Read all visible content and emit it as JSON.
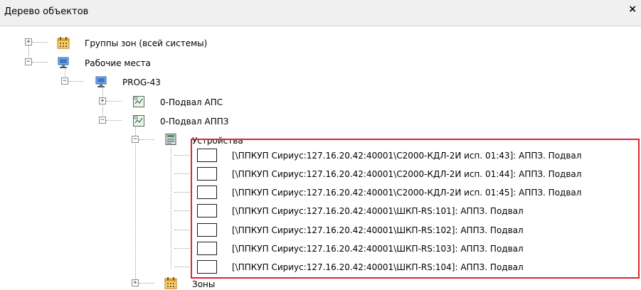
{
  "panel": {
    "title": "Дерево объектов",
    "close_glyph": "×"
  },
  "tree": {
    "zone_groups": "Группы зон (всей системы)",
    "workplaces": "Рабочие места",
    "prog": "PROG-43",
    "aps": "0-Подвал АПС",
    "appz": "0-Подвал АППЗ",
    "devices": "Устройства",
    "device_items": [
      "[\\ППКУП Сириус:127.16.20.42:40001\\С2000-КДЛ-2И исп. 01:43]: АППЗ. Подвал",
      "[\\ППКУП Сириус:127.16.20.42:40001\\С2000-КДЛ-2И исп. 01:44]: АППЗ. Подвал",
      "[\\ППКУП Сириус:127.16.20.42:40001\\С2000-КДЛ-2И исп. 01:45]: АППЗ. Подвал",
      "[\\ППКУП Сириус:127.16.20.42:40001\\ШКП-RS:101]: АППЗ. Подвал",
      "[\\ППКУП Сириус:127.16.20.42:40001\\ШКП-RS:102]: АППЗ. Подвал",
      "[\\ППКУП Сириус:127.16.20.42:40001\\ШКП-RS:103]: АППЗ. Подвал",
      "[\\ППКУП Сириус:127.16.20.42:40001\\ШКП-RS:104]: АППЗ. Подвал"
    ],
    "zones": "Зоны",
    "expander_plus": "+",
    "expander_minus": "−"
  },
  "colors": {
    "highlight": "#e0232e",
    "calendar_icon": "#e8a020",
    "monitor_icon": "#3a78c8"
  },
  "icons": {
    "zone_groups": "calendar-icon",
    "workplaces": "monitor-icon",
    "prog": "monitor-icon",
    "aps": "plan-icon",
    "appz": "plan-icon",
    "devices": "device-panel-icon",
    "zones": "calendar-icon"
  }
}
